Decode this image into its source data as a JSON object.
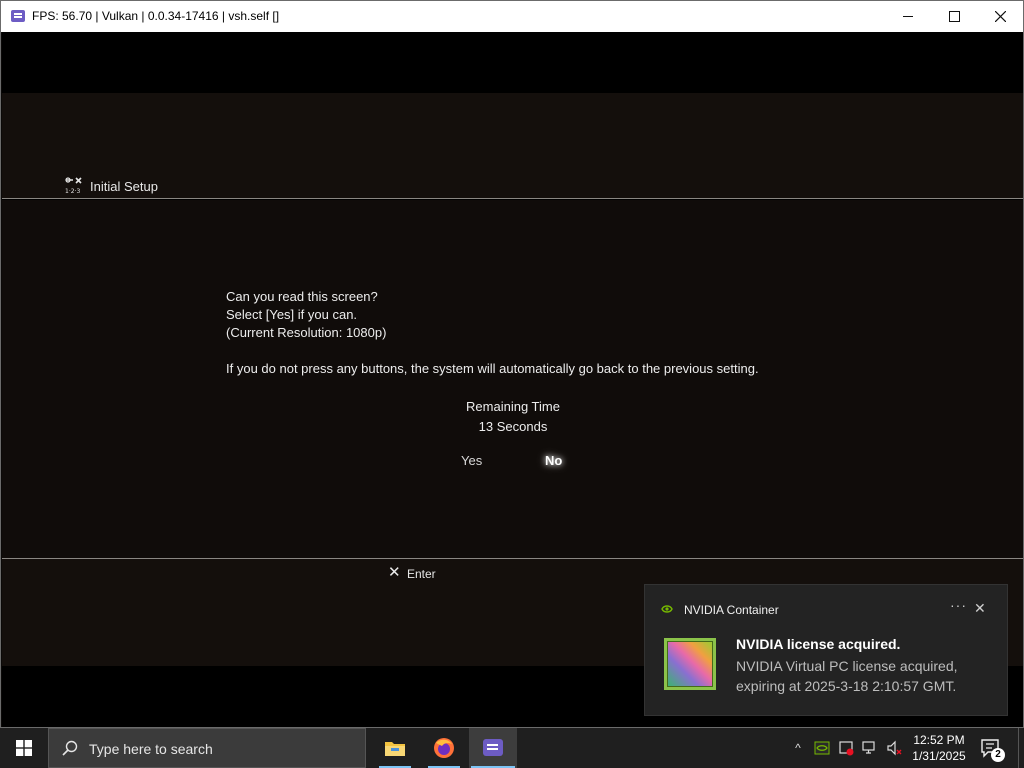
{
  "window": {
    "title": "FPS: 56.70 | Vulkan | 0.0.34-17416 | vsh.self []"
  },
  "screen": {
    "header_label": "Initial Setup",
    "message_lines": [
      "Can you read this screen?",
      "Select [Yes] if you can.",
      "(Current Resolution: 1080p)"
    ],
    "warning": "If you do not press any buttons, the system will automatically go back to the previous setting.",
    "remaining_label": "Remaining Time",
    "remaining_value": "13 Seconds",
    "option_yes": "Yes",
    "option_no": "No",
    "selected_option": "No",
    "enter_glyph": "✕",
    "enter_label": "Enter"
  },
  "notification": {
    "app_name": "NVIDIA Container",
    "more_glyph": "···",
    "close_glyph": "✕",
    "title": "NVIDIA license acquired.",
    "body": "NVIDIA Virtual PC license acquired, expiring at 2025-3-18 2:10:57 GMT.",
    "accent_color": "#76b900"
  },
  "taskbar": {
    "search_placeholder": "Type here to search",
    "apps": [
      "file-explorer-icon",
      "firefox-icon",
      "rpcs3-icon"
    ],
    "tray_chevron": "^",
    "clock_time": "12:52 PM",
    "clock_date": "1/31/2025",
    "notification_count": "2"
  }
}
